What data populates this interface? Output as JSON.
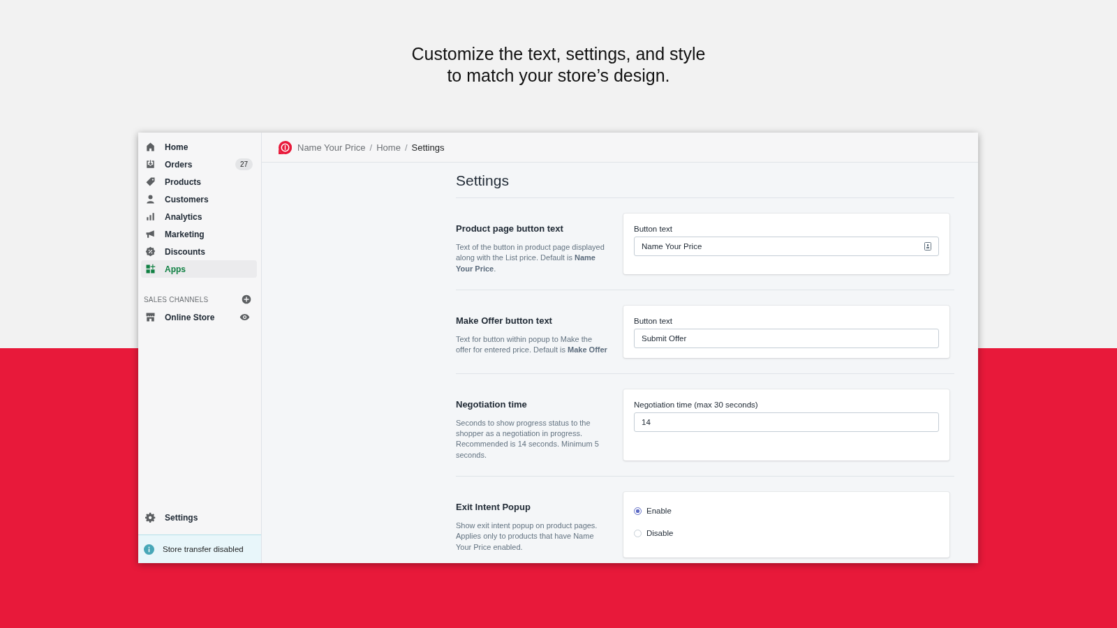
{
  "headline": {
    "lines": [
      "Customize the text, settings, and style",
      "to match your store’s design."
    ]
  },
  "sidebar": {
    "items": [
      {
        "label": "Home",
        "selected": false
      },
      {
        "label": "Orders",
        "selected": false,
        "badge": "27"
      },
      {
        "label": "Products",
        "selected": false
      },
      {
        "label": "Customers",
        "selected": false
      },
      {
        "label": "Analytics",
        "selected": false
      },
      {
        "label": "Marketing",
        "selected": false
      },
      {
        "label": "Discounts",
        "selected": false
      },
      {
        "label": "Apps",
        "selected": true
      }
    ],
    "sales_channels": {
      "heading": "SALES CHANNELS",
      "items": [
        {
          "label": "Online Store",
          "selected": false
        }
      ]
    },
    "settings": {
      "label": "Settings",
      "selected": false
    },
    "notice": "Store transfer disabled"
  },
  "breadcrumb": [
    {
      "label": "Name Your Price",
      "current": false
    },
    {
      "separator": "/",
      "label": "Home",
      "current": false
    },
    {
      "separator": "/",
      "label": "Settings",
      "current": true
    }
  ],
  "page_title": "Settings",
  "sections": [
    {
      "kind": "text",
      "title": "Product page button text",
      "description": "Text of the button in product page displayed along with the List price. Default is **Name Your Price**.",
      "label": "Button text",
      "value": "Name Your Price",
      "trailing_icon": true
    },
    {
      "kind": "text",
      "title": "Make Offer button text",
      "description": "Text for button within popup to Make the offer for entered price. Default is **Make Offer**",
      "label": "Button text",
      "value": "Submit Offer",
      "trailing_icon": false
    },
    {
      "kind": "text",
      "title": "Negotiation time",
      "description": "Seconds to show progress status to the shopper as a negotiation in progress. Recommended is 14 seconds. Minimum 5 seconds.",
      "label": "Negotiation time (max 30 seconds)",
      "value": "14",
      "trailing_icon": false
    },
    {
      "kind": "radio",
      "title": "Exit Intent Popup",
      "description": "Show exit intent popup on product pages. Applies only to products that have Name Your Price enabled.",
      "options": [
        {
          "label": "Enable",
          "selected": true
        },
        {
          "label": "Disable",
          "selected": false
        }
      ]
    }
  ]
}
